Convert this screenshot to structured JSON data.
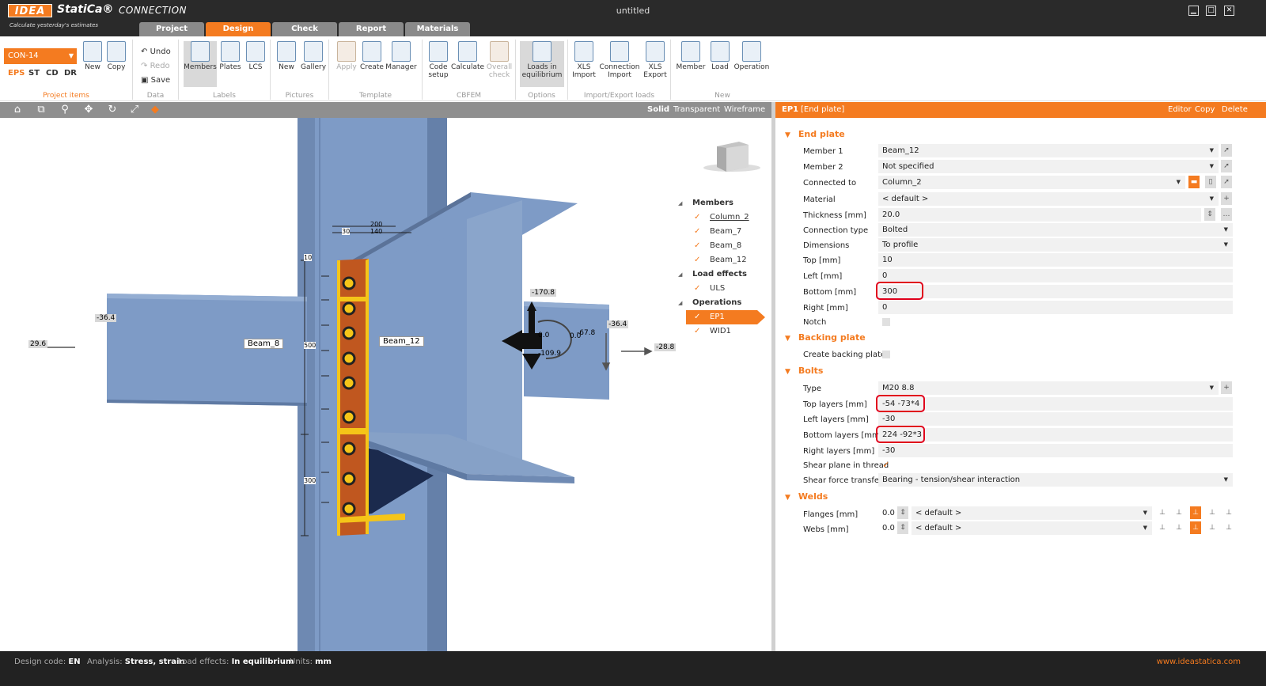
{
  "app": {
    "logo": "IDEA",
    "brand": "StatiCa®",
    "product": "CONNECTION",
    "slogan": "Calculate yesterday's estimates",
    "window_title": "untitled"
  },
  "tabs": [
    "Project",
    "Design",
    "Check",
    "Report",
    "Materials"
  ],
  "active_tab": "Design",
  "ribbon": {
    "connection_selector": "CON-14",
    "view_types": [
      "EPS",
      "ST",
      "CD",
      "DR"
    ],
    "project_items": {
      "label": "Project items",
      "new": "New",
      "copy": "Copy"
    },
    "data": {
      "label": "Data",
      "undo": "Undo",
      "redo": "Redo",
      "save": "Save"
    },
    "labels": {
      "label": "Labels",
      "members": "Members",
      "plates": "Plates",
      "lcs": "LCS"
    },
    "pictures": {
      "label": "Pictures",
      "new": "New",
      "gallery": "Gallery"
    },
    "template": {
      "label": "Template",
      "apply": "Apply",
      "create": "Create",
      "manager": "Manager"
    },
    "cbfem": {
      "label": "CBFEM",
      "code_setup_1": "Code",
      "code_setup_2": "setup",
      "calculate": "Calculate",
      "overall_1": "Overall",
      "overall_2": "check"
    },
    "options": {
      "label": "Options",
      "loads_1": "Loads in",
      "loads_2": "equilibrium"
    },
    "import_export": {
      "label": "Import/Export loads",
      "xls": "XLS",
      "import": "Import",
      "connection": "Connection",
      "export": "Export"
    },
    "new_group": {
      "label": "New",
      "member": "Member",
      "load": "Load",
      "operation": "Operation"
    }
  },
  "view_modes": [
    "Solid",
    "Transparent",
    "Wireframe"
  ],
  "tree": {
    "members_header": "Members",
    "members": [
      "Column_2",
      "Beam_7",
      "Beam_8",
      "Beam_12"
    ],
    "load_effects_header": "Load effects",
    "load_effects": [
      "ULS"
    ],
    "operations_header": "Operations",
    "operations": [
      "EP1",
      "WID1"
    ]
  },
  "scene": {
    "beam_8": "Beam_8",
    "beam_12": "Beam_12",
    "dims": {
      "d200": "200",
      "d140": "140",
      "d30": "30",
      "d10": "10",
      "d500": "500",
      "d300": "300"
    },
    "loads": {
      "l1": "-36.4",
      "l2": "29.6",
      "l3": "-170.8",
      "l4": "-36.4",
      "l5": "-28.8",
      "l6": "-67.8",
      "l7": "-109.9",
      "l8": "0.0",
      "l9": "0.0"
    }
  },
  "props_header": {
    "id": "EP1",
    "name": "[End plate]",
    "editor": "Editor",
    "copy": "Copy",
    "delete": "Delete"
  },
  "end_plate": {
    "title": "End plate",
    "rows": [
      {
        "label": "Member 1",
        "value": "Beam_12"
      },
      {
        "label": "Member 2",
        "value": "Not specified"
      },
      {
        "label": "Connected to",
        "value": "Column_2"
      },
      {
        "label": "Material",
        "value": "< default >"
      },
      {
        "label": "Thickness [mm]",
        "value": "20.0"
      },
      {
        "label": "Connection type",
        "value": "Bolted"
      },
      {
        "label": "Dimensions",
        "value": "To profile"
      },
      {
        "label": "Top [mm]",
        "value": "10"
      },
      {
        "label": "Left [mm]",
        "value": "0"
      },
      {
        "label": "Bottom [mm]",
        "value": "300"
      },
      {
        "label": "Right [mm]",
        "value": "0"
      },
      {
        "label": "Notch",
        "value": ""
      }
    ]
  },
  "backing_plate": {
    "title": "Backing plate",
    "create_label": "Create backing plate"
  },
  "bolts": {
    "title": "Bolts",
    "rows": [
      {
        "label": "Type",
        "value": "M20 8.8"
      },
      {
        "label": "Top layers [mm]",
        "value": "-54 -73*4"
      },
      {
        "label": "Left layers [mm]",
        "value": "-30"
      },
      {
        "label": "Bottom layers [mm]",
        "value": "224 -92*3"
      },
      {
        "label": "Right layers [mm]",
        "value": "-30"
      },
      {
        "label": "Shear plane in thread",
        "value": ""
      },
      {
        "label": "Shear force transfer",
        "value": "Bearing - tension/shear interaction"
      }
    ]
  },
  "welds": {
    "title": "Welds",
    "rows": [
      {
        "label": "Flanges [mm]",
        "thickness": "0.0",
        "material": "< default >"
      },
      {
        "label": "Webs [mm]",
        "thickness": "0.0",
        "material": "< default >"
      }
    ]
  },
  "status": {
    "design_code_label": "Design code:",
    "design_code": "EN",
    "analysis_label": "Analysis:",
    "analysis": "Stress, strain",
    "load_effects_label": "Load effects:",
    "load_effects": "In equilibrium",
    "units_label": "Units:",
    "units": "mm",
    "url": "www.ideastatica.com"
  },
  "colors": {
    "accent": "#f47b20",
    "steel": "#7e9bc6",
    "plate": "#c0571f",
    "highlight": "#e0001b"
  }
}
